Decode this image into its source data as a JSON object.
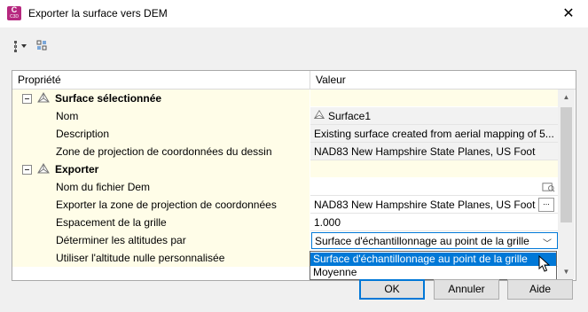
{
  "window": {
    "title": "Exporter la surface vers DEM",
    "app_icon_letter": "C",
    "app_icon_sub": "C3D",
    "close_glyph": "✕"
  },
  "toolbar": {
    "icons": [
      "expand-all-icon",
      "collapse-all-icon"
    ]
  },
  "grid": {
    "columns": {
      "property": "Propriété",
      "value": "Valeur"
    },
    "categories": [
      {
        "label": "Surface sélectionnée",
        "rows": [
          {
            "label": "Nom",
            "value": "Surface1",
            "icon": "surface-icon",
            "readonly": true
          },
          {
            "label": "Description",
            "value": "Existing surface created from aerial mapping of 5...",
            "readonly": true
          },
          {
            "label": "Zone de projection de coordonnées du dessin",
            "value": "NAD83 New Hampshire State Planes, US Foot",
            "readonly": true
          }
        ]
      },
      {
        "label": "Exporter",
        "rows": [
          {
            "label": "Nom du fichier Dem",
            "value": "",
            "icon": "browse-folder-icon"
          },
          {
            "label": "Exporter la zone de projection de coordonnées",
            "value": "NAD83 New Hampshire State Planes, US Foot",
            "button": "..."
          },
          {
            "label": "Espacement de la grille",
            "value": "1.000"
          },
          {
            "label": "Déterminer les altitudes par",
            "value": "Surface d'échantillonnage au point de la grille",
            "chevron": "﹀"
          },
          {
            "label": "Utiliser l'altitude nulle personnalisée",
            "value": ""
          }
        ]
      }
    ]
  },
  "dropdown": {
    "options": [
      "Surface d'échantillonnage au point de la grille",
      "Moyenne"
    ],
    "highlighted": 0
  },
  "buttons": {
    "ok": "OK",
    "cancel": "Annuler",
    "help": "Aide"
  },
  "scrollbar": {
    "up": "▲",
    "down": "▼"
  },
  "colors": {
    "accent": "#0078d7",
    "category_bg": "#fffde8",
    "app_icon": "#b6287f"
  }
}
